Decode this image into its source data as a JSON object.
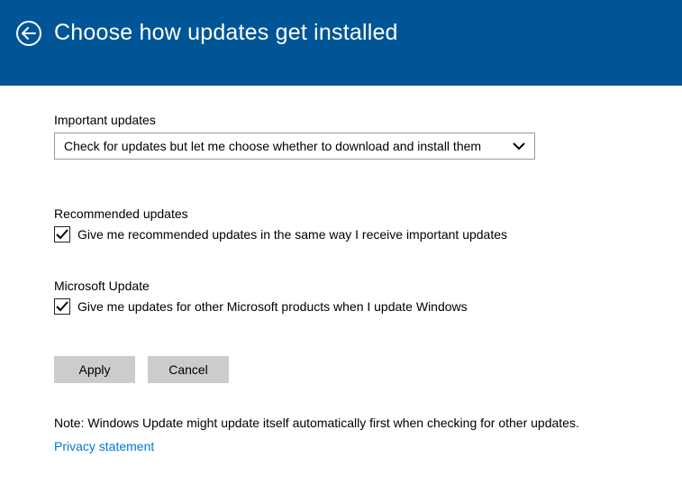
{
  "header": {
    "title": "Choose how updates get installed"
  },
  "important": {
    "label": "Important updates",
    "selected": "Check for updates but let me choose whether to download and install them"
  },
  "recommended": {
    "label": "Recommended updates",
    "checkbox_label": "Give me recommended updates in the same way I receive important updates"
  },
  "microsoft": {
    "label": "Microsoft Update",
    "checkbox_label": "Give me updates for other Microsoft products when I update Windows"
  },
  "buttons": {
    "apply": "Apply",
    "cancel": "Cancel"
  },
  "footer": {
    "note": "Note: Windows Update might update itself automatically first when checking for other updates.",
    "privacy": "Privacy statement"
  }
}
